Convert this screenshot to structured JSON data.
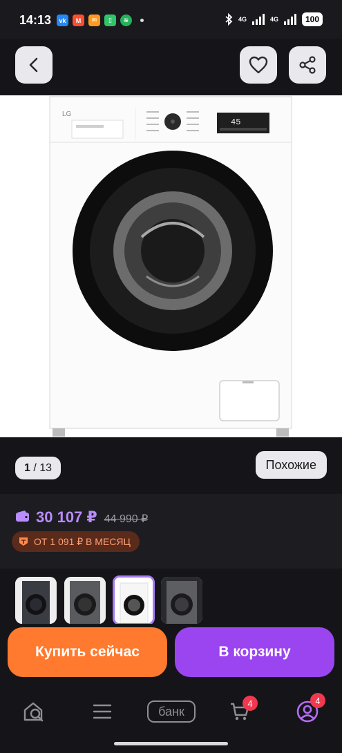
{
  "status_bar": {
    "time": "14:13",
    "notification_apps": [
      "vk",
      "mail",
      "email",
      "sim",
      "spotify"
    ],
    "network_1": "4G",
    "network_2": "4G",
    "battery": "100"
  },
  "product": {
    "brand_on_image": "LG",
    "display_on_image": "45"
  },
  "gallery": {
    "current": "1",
    "total": "/ 13",
    "similar_label": "Похожие"
  },
  "price": {
    "current": "30 107 ₽",
    "old": "44 990 ₽",
    "installment": "ОТ 1 091 ₽ В МЕСЯЦ",
    "current_color": "#b98cff",
    "installment_color": "#ffa175"
  },
  "thumbnails": {
    "selected_index": 2,
    "items": [
      "front-dark-door",
      "front-grey-body",
      "front-white",
      "front-graphite"
    ]
  },
  "actions": {
    "buy_now": "Купить сейчас",
    "add_to_cart": "В корзину",
    "buy_now_color": "#ff7a2e",
    "add_to_cart_color": "#9b45f0"
  },
  "tab_bar": {
    "bank_label": "банк",
    "cart_badge": "4",
    "profile_badge": "4"
  }
}
